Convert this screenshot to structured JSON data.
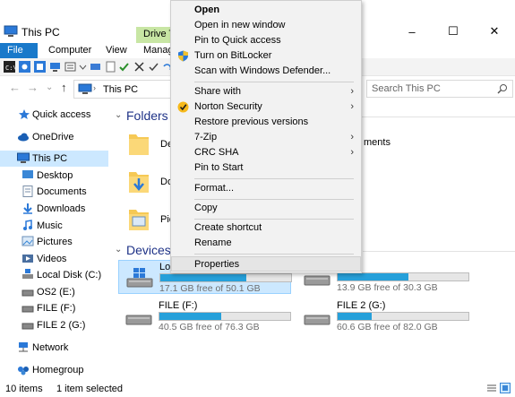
{
  "window": {
    "title": "This PC",
    "minimize": "–",
    "maximize": "☐",
    "close": "✕"
  },
  "ribbon": {
    "file": "File",
    "computer": "Computer",
    "view": "View",
    "drive_tools": "Drive Too",
    "manage": "Manage"
  },
  "address": {
    "back": "←",
    "forward": "→",
    "recent": "⌄",
    "up": "↑",
    "path": "This PC"
  },
  "search": {
    "placeholder": "Search This PC"
  },
  "nav": {
    "quick_access": "Quick access",
    "onedrive": "OneDrive",
    "this_pc": "This PC",
    "desktop": "Desktop",
    "documents": "Documents",
    "downloads": "Downloads",
    "music": "Music",
    "pictures": "Pictures",
    "videos": "Videos",
    "local_disk": "Local Disk (C:)",
    "os2": "OS2 (E:)",
    "file_f": "FILE (F:)",
    "file2_g": "FILE 2 (G:)",
    "network": "Network",
    "homegroup": "Homegroup"
  },
  "content": {
    "folders_header": "Folders (6",
    "folders": [
      {
        "label": "De"
      },
      {
        "label": "Do"
      },
      {
        "label": "Pic"
      }
    ],
    "folder_right_label": "ments",
    "devices_header": "Devices a",
    "drives": [
      {
        "name": "Lo",
        "free": "17.1 GB free of 50.1 GB",
        "used": 0.66
      },
      {
        "name": "",
        "free": "13.9 GB free of 30.3 GB",
        "used": 0.54
      },
      {
        "name": "FILE (F:)",
        "free": "40.5 GB free of 76.3 GB",
        "used": 0.47
      },
      {
        "name": "FILE 2 (G:)",
        "free": "60.6 GB free of 82.0 GB",
        "used": 0.26
      }
    ]
  },
  "status": {
    "items": "10 items",
    "selected": "1 item selected"
  },
  "context_menu": {
    "open": "Open",
    "open_new_window": "Open in new window",
    "pin_quick_access": "Pin to Quick access",
    "bitlocker": "Turn on BitLocker",
    "defender": "Scan with Windows Defender...",
    "share_with": "Share with",
    "norton": "Norton Security",
    "restore": "Restore previous versions",
    "zip": "7-Zip",
    "crc": "CRC SHA",
    "pin_start": "Pin to Start",
    "format": "Format...",
    "copy": "Copy",
    "create_shortcut": "Create shortcut",
    "rename": "Rename",
    "properties": "Properties"
  },
  "colors": {
    "accent": "#1979ca",
    "bar_fill": "#26a0da",
    "selection": "#cce8ff",
    "drive_tools": "#c8e6a4"
  }
}
